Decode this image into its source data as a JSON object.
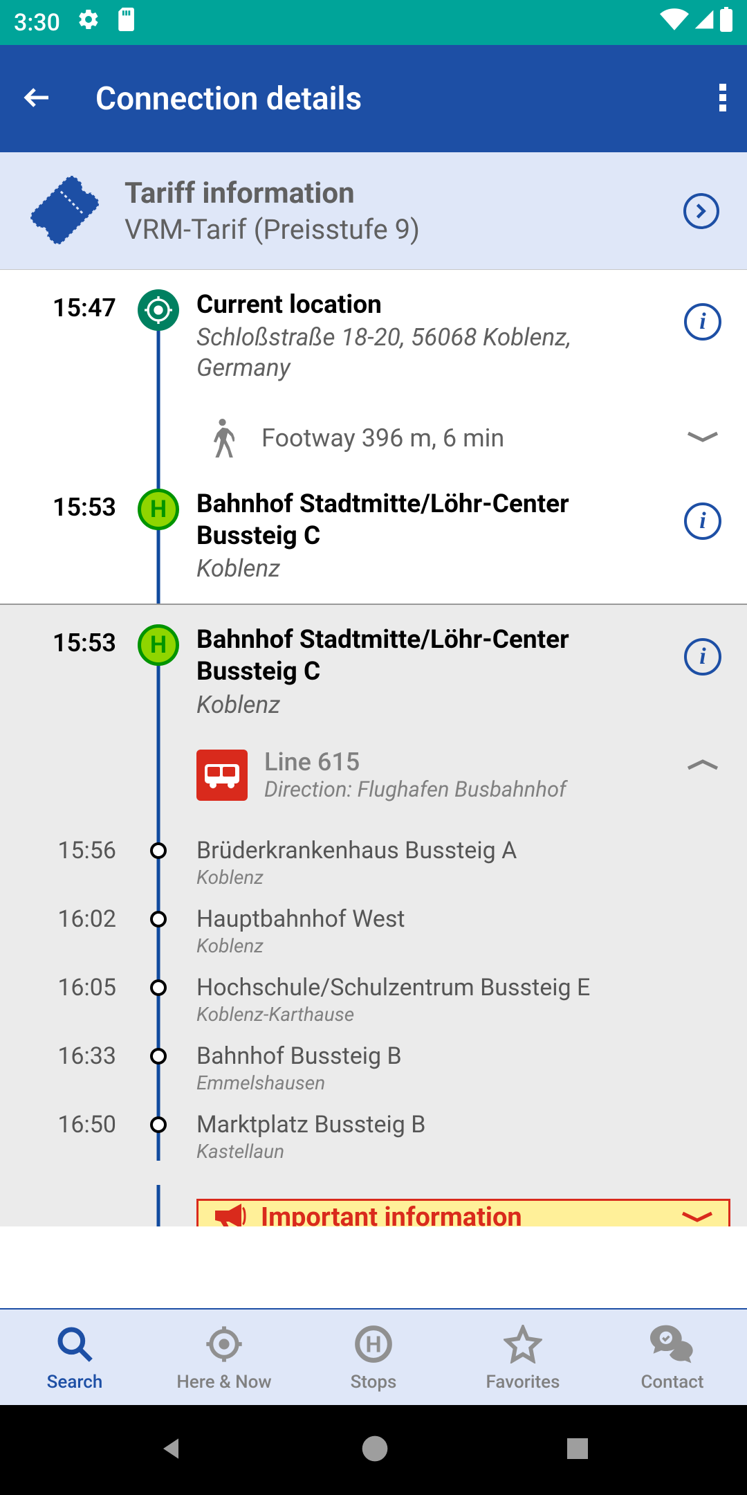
{
  "status_bar": {
    "time": "3:30"
  },
  "app_bar": {
    "title": "Connection details"
  },
  "tariff": {
    "title": "Tariff information",
    "subtitle": "VRM-Tarif (Preisstufe 9)"
  },
  "journey": {
    "start": {
      "time": "15:47",
      "name": "Current location",
      "detail": "Schloßstraße 18-20, 56068 Koblenz, Germany",
      "foot": "Footway 396 m, 6 min"
    },
    "walk_end": {
      "time": "15:53",
      "name": "Bahnhof Stadtmitte/Löhr-Center Bussteig C",
      "city": "Koblenz"
    },
    "bus_start": {
      "time": "15:53",
      "name": "Bahnhof Stadtmitte/Löhr-Center Bussteig C",
      "city": "Koblenz",
      "line": "Line 615",
      "direction": "Direction: Flughafen Busbahnhof"
    },
    "stops": [
      {
        "time": "15:56",
        "name": "Brüderkrankenhaus Bussteig A",
        "city": "Koblenz"
      },
      {
        "time": "16:02",
        "name": "Hauptbahnhof West",
        "city": "Koblenz"
      },
      {
        "time": "16:05",
        "name": "Hochschule/Schulzentrum Bussteig E",
        "city": "Koblenz-Karthause"
      },
      {
        "time": "16:33",
        "name": "Bahnhof Bussteig B",
        "city": "Emmelshausen"
      },
      {
        "time": "16:50",
        "name": "Marktplatz Bussteig B",
        "city": "Kastellaun"
      }
    ],
    "important": "Important information"
  },
  "bottom_nav": {
    "items": [
      "Search",
      "Here & Now",
      "Stops",
      "Favorites",
      "Contact"
    ]
  }
}
